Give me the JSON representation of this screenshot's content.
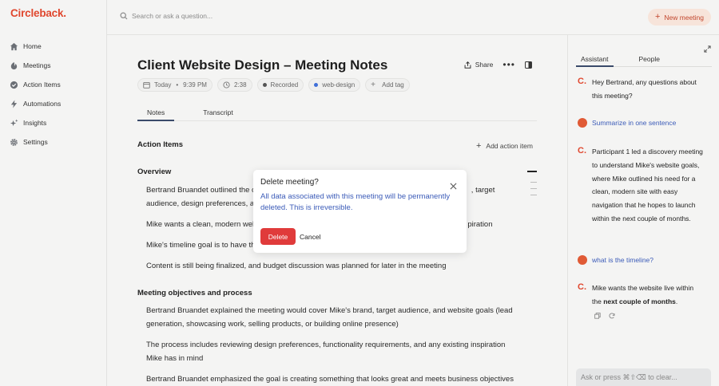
{
  "app": {
    "logo": "Circleback",
    "accent": "#e0472e"
  },
  "sidebar": {
    "items": [
      {
        "label": "Home",
        "icon": "home-icon"
      },
      {
        "label": "Meetings",
        "icon": "meetings-icon"
      },
      {
        "label": "Action Items",
        "icon": "check-circle-icon"
      },
      {
        "label": "Automations",
        "icon": "bolt-icon"
      },
      {
        "label": "Insights",
        "icon": "sparkle-icon"
      },
      {
        "label": "Settings",
        "icon": "gear-icon"
      }
    ]
  },
  "topbar": {
    "search_placeholder": "Search or ask a question...",
    "new_meeting_label": "New meeting"
  },
  "meeting": {
    "title": "Client Website Design – Meeting Notes",
    "share_label": "Share",
    "meta": {
      "date": "Today",
      "time": "9:39 PM",
      "duration": "2:38",
      "recorded": "Recorded",
      "tag": "web-design",
      "add_tag": "Add tag"
    },
    "tabs": [
      "Notes",
      "Transcript"
    ],
    "action_items_heading": "Action Items",
    "add_action_item": "Add action item",
    "overview_heading": "Overview",
    "overview_bullets": [
      {
        "line1": "Bertrand Bruandet outlined the c",
        "line1_tail": ", target",
        "line2": "audience, design preferences, a"
      },
      {
        "line1": "Mike wants a clean, modern web",
        "line1_tail": "piration"
      },
      {
        "line1": "Mike's timeline goal is to have th"
      },
      {
        "line1": "Content is still being finalized, and budget discussion was planned for later in the meeting"
      }
    ],
    "objectives_heading": "Meeting objectives and process",
    "objective_bullets": [
      {
        "line1": "Bertrand Bruandet explained the meeting would cover Mike's brand, target audience, and website goals (lead",
        "line2": "generation, showcasing work, selling products, or building online presence)"
      },
      {
        "line1": "The process includes reviewing design preferences, functionality requirements, and any existing inspiration",
        "line2": "Mike has in mind"
      },
      {
        "line1": "Bertrand Bruandet emphasized the goal is creating something that looks great and meets business objectives"
      }
    ]
  },
  "assistant": {
    "tabs": [
      "Assistant",
      "People"
    ],
    "messages": [
      {
        "type": "assistant",
        "text": "Hey Bertrand, any questions about this meeting?"
      },
      {
        "type": "user",
        "text": "Summarize in one sentence"
      },
      {
        "type": "assistant",
        "text": "Participant 1 led a discovery meeting to understand Mike's website goals, where Mike outlined his need for a clean, modern site with easy navigation that he hopes to launch within the next couple of months."
      },
      {
        "type": "user",
        "text": "what is the timeline?"
      },
      {
        "type": "assistant",
        "text_pre": "Mike wants the website live within the ",
        "text_bold": "next couple of months",
        "text_post": "."
      }
    ],
    "input_placeholder": "Ask or press ⌘⇧⌫ to clear..."
  },
  "modal": {
    "title": "Delete meeting?",
    "body": "All data associated with this meeting will be permanently deleted. This is irreversible.",
    "delete_label": "Delete",
    "cancel_label": "Cancel",
    "danger_color": "#e03b3b"
  }
}
